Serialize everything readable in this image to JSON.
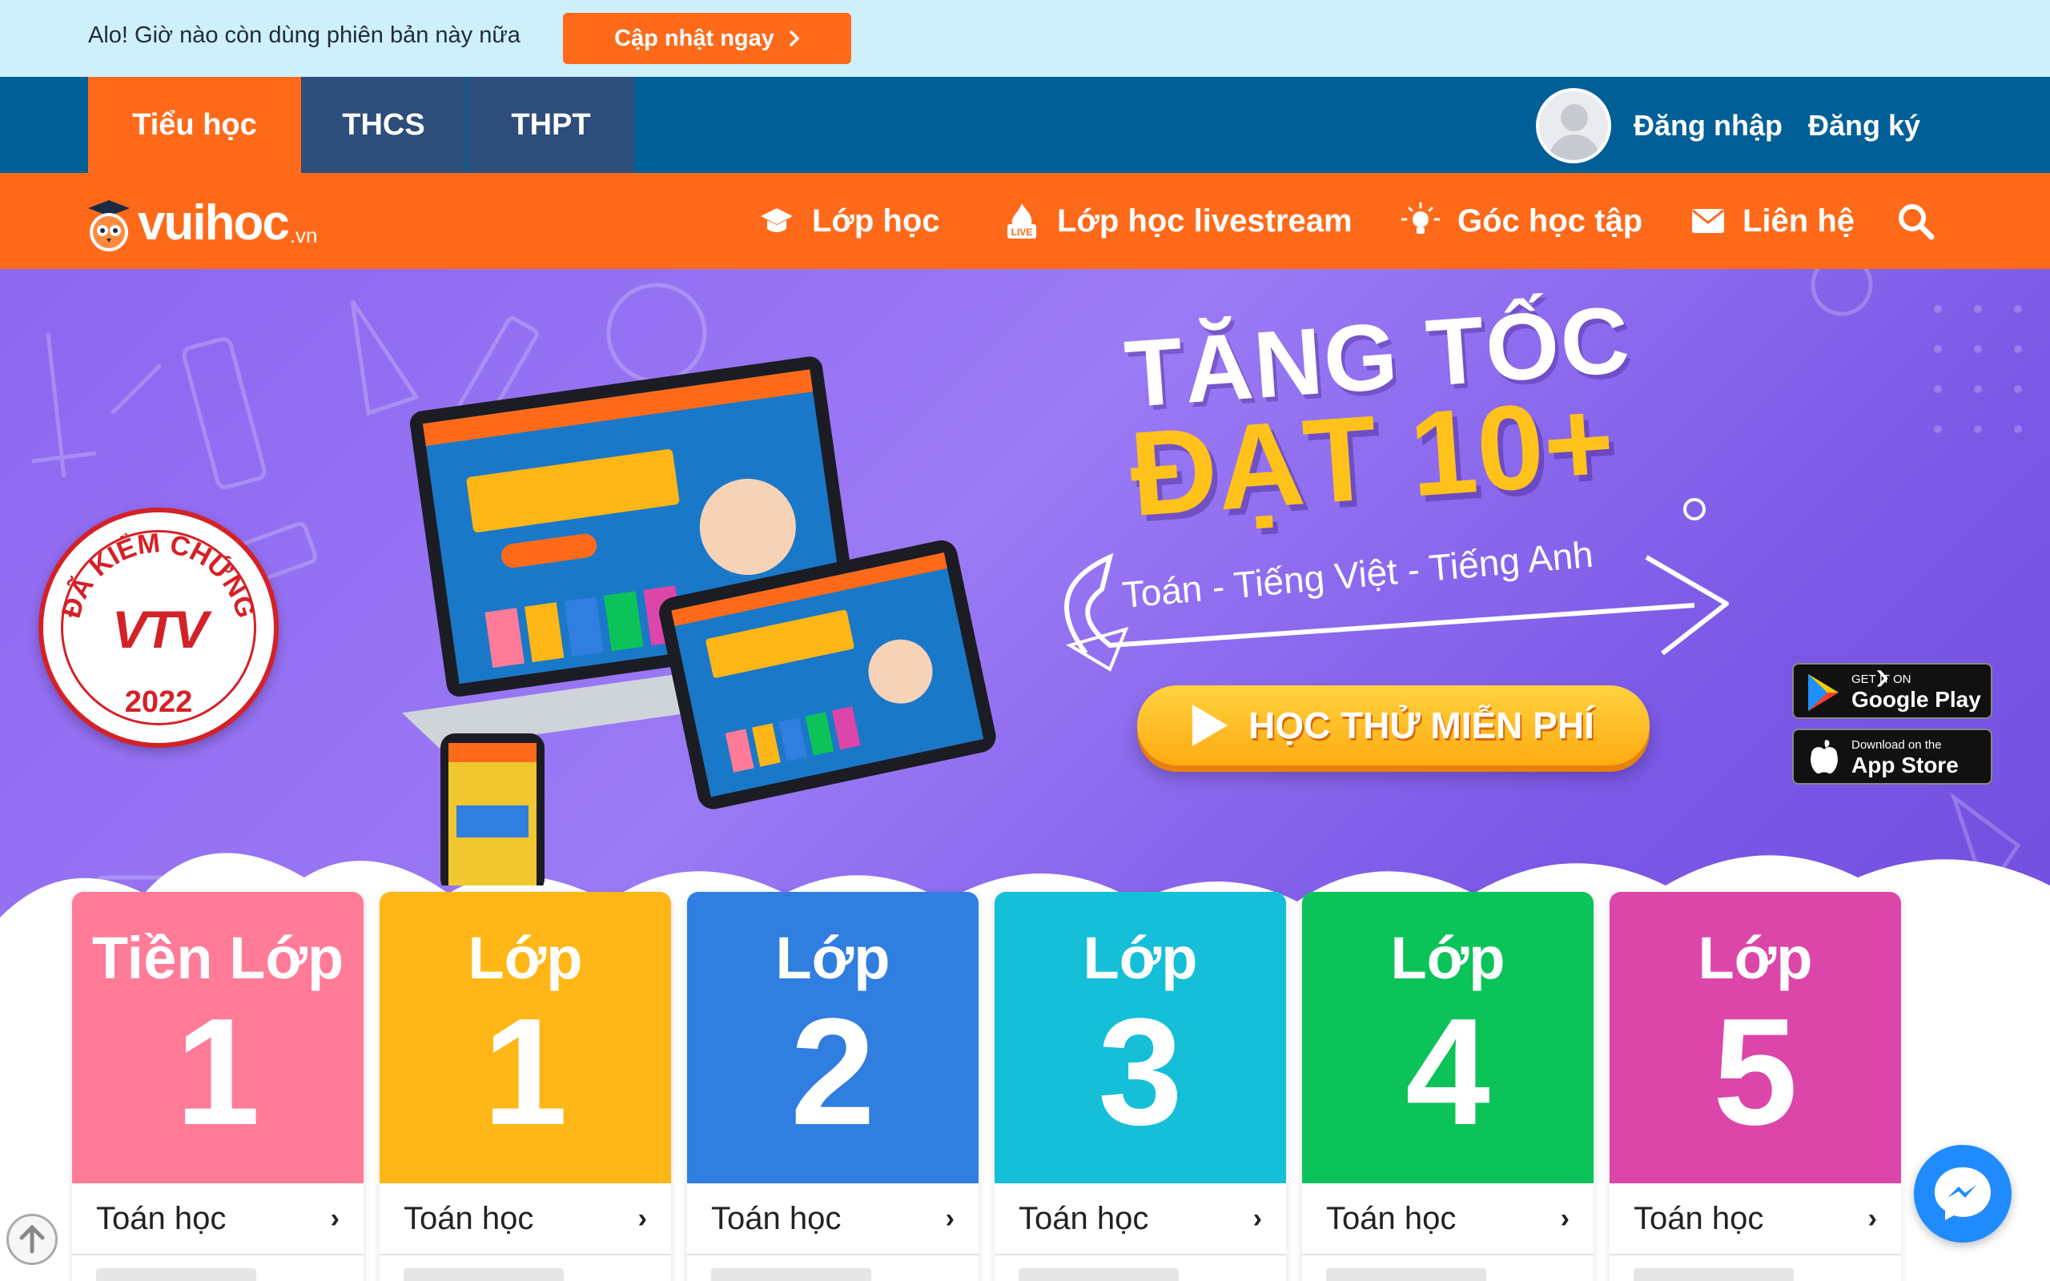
{
  "update_banner": {
    "message": "Alo! Giờ nào còn dùng phiên bản này nữa",
    "button_label": "Cập nhật ngay"
  },
  "levels": {
    "tabs": [
      "Tiểu học",
      "THCS",
      "THPT"
    ],
    "active": "Tiểu học"
  },
  "auth": {
    "login": "Đăng nhập",
    "register": "Đăng ký"
  },
  "logo": {
    "text": "vuihoc",
    "suffix": ".vn"
  },
  "main_nav": {
    "items": [
      "Lớp học",
      "Lớp học livestream",
      "Góc học tập",
      "Liên hệ"
    ],
    "live_badge": "LIVE"
  },
  "hero": {
    "badge_text": "ĐÃ KIỂM CHỨNG",
    "badge_logo": "VTV",
    "badge_year": "2022",
    "headline_1": "TĂNG TỐC",
    "headline_2": "ĐẠT 10+",
    "subjects": "Toán - Tiếng Việt - Tiếng Anh",
    "cta": "HỌC THỬ MIỄN PHÍ",
    "google_play_small": "GET IT ON",
    "google_play_big": "Google Play",
    "app_store_small": "Download on the",
    "app_store_big": "App Store",
    "prev": "‹",
    "next": "›"
  },
  "grades": [
    {
      "label": "Tiền Lớp",
      "number": "1",
      "subject": "Toán học",
      "color": "#ff7b98"
    },
    {
      "label": "Lớp",
      "number": "1",
      "subject": "Toán học",
      "color": "#ffb617"
    },
    {
      "label": "Lớp",
      "number": "2",
      "subject": "Toán học",
      "color": "#2f7ee0"
    },
    {
      "label": "Lớp",
      "number": "3",
      "subject": "Toán học",
      "color": "#14bfd7"
    },
    {
      "label": "Lớp",
      "number": "4",
      "subject": "Toán học",
      "color": "#0cc35a"
    },
    {
      "label": "Lớp",
      "number": "5",
      "subject": "Toán học",
      "color": "#dc46a8"
    }
  ],
  "colors": {
    "brand_orange": "#ff6a1a",
    "level_bar": "#005f97",
    "tab_inactive": "#2d4d7b",
    "hero_purple": "#8d66f0",
    "cta_yellow": "#ffc21a"
  },
  "icons": {
    "nav_lophoc": "graduation-cap-icon",
    "nav_livestream": "live-fire-icon",
    "nav_goc": "lightbulb-icon",
    "nav_lienhe": "envelope-icon",
    "search": "search-icon",
    "messenger": "messenger-icon",
    "scroll_top": "arrow-up-icon"
  }
}
